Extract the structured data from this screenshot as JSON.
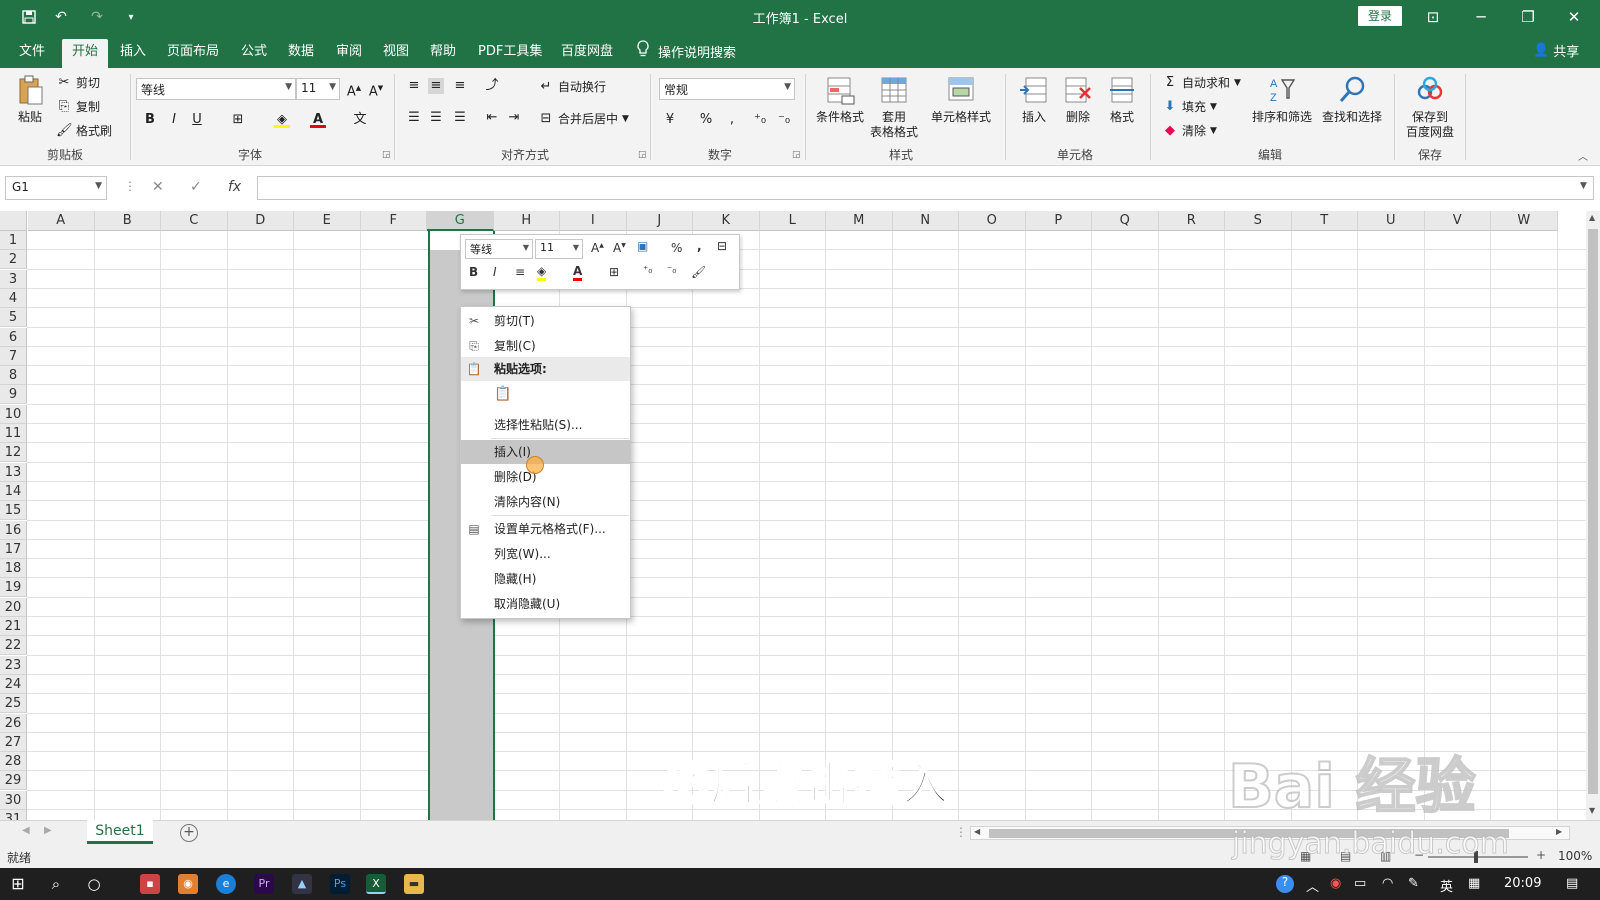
{
  "window": {
    "title": "工作簿1 - Excel",
    "login": "登录"
  },
  "tabs": [
    "文件",
    "开始",
    "插入",
    "页面布局",
    "公式",
    "数据",
    "审阅",
    "视图",
    "帮助",
    "PDF工具集",
    "百度网盘"
  ],
  "tell_me": "操作说明搜索",
  "share": "共享",
  "ribbon": {
    "clipboard": {
      "paste": "粘贴",
      "cut": "剪切",
      "copy": "复制",
      "format_painter": "格式刷",
      "label": "剪贴板"
    },
    "font": {
      "name": "等线",
      "size": "11",
      "label": "字体",
      "bold": "B",
      "italic": "I",
      "underline": "U"
    },
    "align": {
      "wrap": "自动换行",
      "merge": "合并后居中",
      "label": "对齐方式"
    },
    "number": {
      "format": "常规",
      "label": "数字"
    },
    "styles": {
      "conditional": "条件格式",
      "table1": "套用",
      "table2": "表格格式",
      "cell_styles": "单元格样式",
      "label": "样式"
    },
    "cells": {
      "insert": "插入",
      "delete": "删除",
      "format": "格式",
      "label": "单元格"
    },
    "edit": {
      "autosum": "自动求和",
      "fill": "填充",
      "clear": "清除",
      "sort": "排序和筛选",
      "find": "查找和选择",
      "label": "编辑"
    },
    "save": {
      "line1": "保存到",
      "line2": "百度网盘",
      "label": "保存"
    }
  },
  "formula": {
    "namebox": "G1",
    "fx": "fx"
  },
  "columns": [
    "A",
    "B",
    "C",
    "D",
    "E",
    "F",
    "G",
    "H",
    "I",
    "J",
    "K",
    "L",
    "M",
    "N",
    "O",
    "P",
    "Q",
    "R",
    "S",
    "T",
    "U",
    "V",
    "W"
  ],
  "rows": [
    "1",
    "2",
    "3",
    "4",
    "5",
    "6",
    "7",
    "8",
    "9",
    "10",
    "11",
    "12",
    "13",
    "14",
    "15",
    "16",
    "17",
    "18",
    "19",
    "20",
    "21",
    "22",
    "23",
    "24",
    "25",
    "26",
    "27",
    "28",
    "29",
    "30",
    "31"
  ],
  "mini_toolbar": {
    "font": "等线",
    "size": "11",
    "bold": "B",
    "italic": "I"
  },
  "context_menu": {
    "cut": "剪切(T)",
    "copy": "复制(C)",
    "paste_options": "粘贴选项:",
    "paste_special": "选择性粘贴(S)...",
    "insert": "插入(I)",
    "delete": "删除(D)",
    "clear": "清除内容(N)",
    "format_cells": "设置单元格格式(F)...",
    "col_width": "列宽(W)...",
    "hide": "隐藏(H)",
    "unhide": "取消隐藏(U)"
  },
  "sheet": {
    "name": "Sheet1"
  },
  "status": {
    "ready": "就绪",
    "zoom": "100%"
  },
  "taskbar": {
    "time": "20:09",
    "ime": "英"
  },
  "caption": "然后点击插入",
  "watermark": {
    "main": "Bai 经验",
    "sub": "jingyan.baidu.com"
  },
  "colors": {
    "accent": "#217346"
  }
}
